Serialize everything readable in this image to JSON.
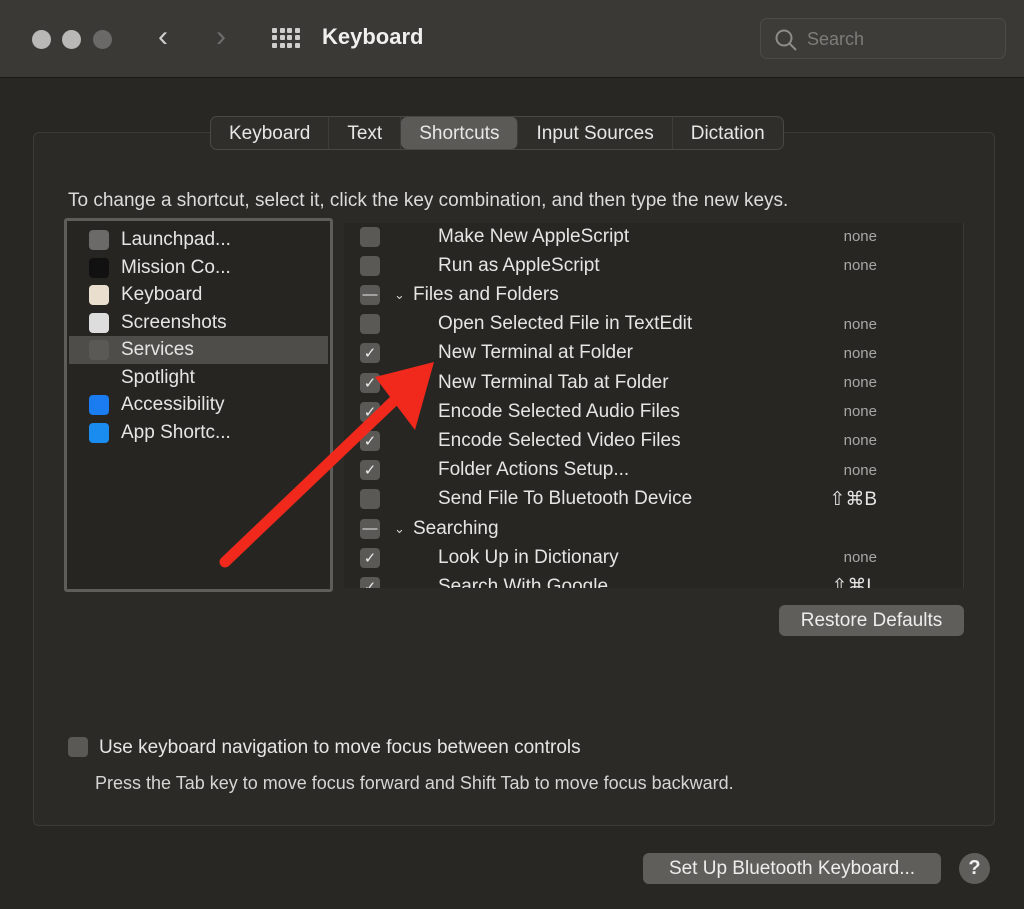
{
  "window": {
    "title": "Keyboard",
    "search_placeholder": "Search",
    "back": "‹",
    "forward": "›"
  },
  "tabs": [
    {
      "label": "Keyboard"
    },
    {
      "label": "Text"
    },
    {
      "label": "Shortcuts",
      "selected": true
    },
    {
      "label": "Input Sources"
    },
    {
      "label": "Dictation"
    }
  ],
  "instructions": "To change a shortcut, select it, click the key combination, and then type the new keys.",
  "categories": [
    {
      "label": "Launchpad...",
      "icon": "launchpad-icon",
      "color": "#6b6a68"
    },
    {
      "label": "Mission Co...",
      "icon": "mission-control-icon",
      "color": "#111"
    },
    {
      "label": "Keyboard",
      "icon": "keyboard-icon",
      "color": "#eadfcf"
    },
    {
      "label": "Screenshots",
      "icon": "screenshot-icon",
      "color": "#ddd"
    },
    {
      "label": "Services",
      "icon": "gear-icon",
      "color": "#5a5956",
      "selected": true
    },
    {
      "label": "Spotlight",
      "icon": "magnifier-icon",
      "color": "transparent"
    },
    {
      "label": "Accessibility",
      "icon": "accessibility-icon",
      "color": "#1a7cf0"
    },
    {
      "label": "App Shortc...",
      "icon": "app-store-icon",
      "color": "#1a8cf0"
    }
  ],
  "shortcuts": [
    {
      "label": "Make New AppleScript",
      "state": "off",
      "shortcut": "none"
    },
    {
      "label": "Run as AppleScript",
      "state": "off",
      "shortcut": "none"
    },
    {
      "label": "Files and Folders",
      "state": "mixed",
      "section": true
    },
    {
      "label": "Open Selected File in TextEdit",
      "state": "off",
      "shortcut": "none"
    },
    {
      "label": "New Terminal at Folder",
      "state": "on",
      "shortcut": "none"
    },
    {
      "label": "New Terminal Tab at Folder",
      "state": "on",
      "shortcut": "none"
    },
    {
      "label": "Encode Selected Audio Files",
      "state": "on",
      "shortcut": "none"
    },
    {
      "label": "Encode Selected Video Files",
      "state": "on",
      "shortcut": "none"
    },
    {
      "label": "Folder Actions Setup...",
      "state": "on",
      "shortcut": "none"
    },
    {
      "label": "Send File To Bluetooth Device",
      "state": "off",
      "shortcut": "⇧⌘B"
    },
    {
      "label": "Searching",
      "state": "mixed",
      "section": true
    },
    {
      "label": "Look Up in Dictionary",
      "state": "on",
      "shortcut": "none"
    },
    {
      "label": "Search With Google",
      "state": "on",
      "shortcut": "⇧⌘L"
    }
  ],
  "restore_defaults": "Restore Defaults",
  "keyboard_nav": {
    "label": "Use keyboard navigation to move focus between controls",
    "checked": false,
    "hint": "Press the Tab key to move focus forward and Shift Tab to move focus backward."
  },
  "bluetooth_button": "Set Up Bluetooth Keyboard...",
  "help": "?",
  "annotation_color": "#f0291c"
}
